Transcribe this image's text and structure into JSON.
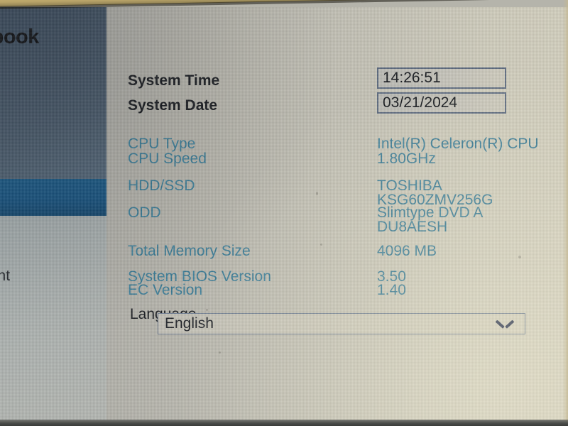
{
  "device": {
    "brand_partial": "abook",
    "screen_type": "bios-setup"
  },
  "sidebar": {
    "selected_item_label": "",
    "items": [
      {
        "label": "",
        "selected": true
      },
      {
        "label": "gement",
        "selected": false
      }
    ],
    "colors": {
      "panel_top": "#4b5c6d",
      "selection": "#1d5a85",
      "panel_bottom": "#adb2b0"
    }
  },
  "main": {
    "colors": {
      "info_text": "#3b7d98",
      "editable_text": "#1c1f24",
      "background": "#c7c4b8",
      "field_border": "#5f6d82"
    },
    "editable_rows": [
      {
        "label": "System Time",
        "value": "14:26:51"
      },
      {
        "label": "System Date",
        "value": "03/21/2024"
      }
    ],
    "info_rows": [
      {
        "label": "CPU Type",
        "value": "Intel(R) Celeron(R) CPU"
      },
      {
        "label": "CPU Speed",
        "value": "1.80GHz"
      },
      {
        "label": "HDD/SSD",
        "value": "TOSHIBA"
      },
      {
        "label": "",
        "value": "KSG60ZMV256G"
      },
      {
        "label": "ODD",
        "value": "Slimtype DVD A"
      },
      {
        "label": "",
        "value": "DU8AESH"
      },
      {
        "label": "Total Memory Size",
        "value": "4096 MB"
      },
      {
        "label": "System BIOS Version",
        "value": "3.50"
      },
      {
        "label": "EC Version",
        "value": "1.40"
      }
    ],
    "language": {
      "label": "Language",
      "selected": "English",
      "chevron_icon": "chevron-down-icon"
    }
  }
}
